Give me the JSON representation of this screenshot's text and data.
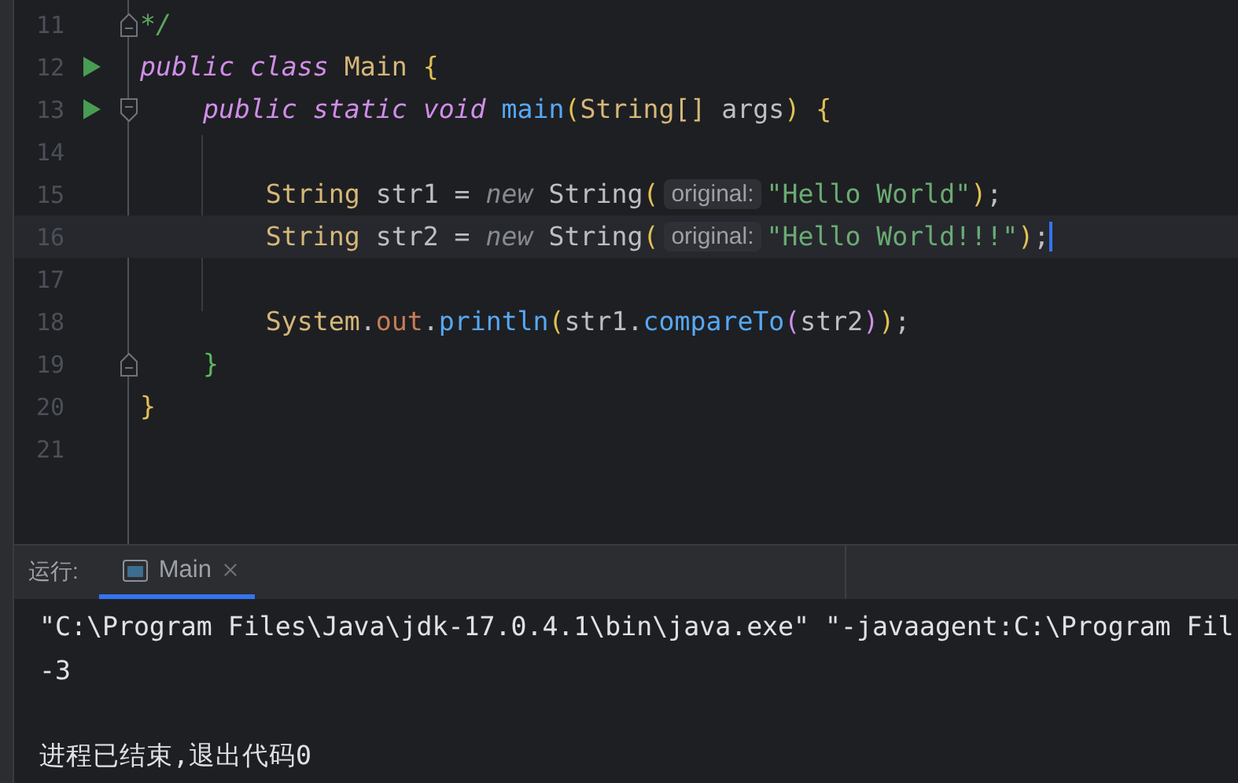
{
  "editor": {
    "lines": [
      {
        "number": "11",
        "run": false,
        "fold_start": false,
        "fold_end": true,
        "current": false,
        "tokens": [
          {
            "kind": "comment",
            "text": "*/"
          }
        ]
      },
      {
        "number": "12",
        "run": true,
        "fold_start": false,
        "fold_end": false,
        "current": false,
        "tokens": [
          {
            "kind": "kw",
            "text": "public class "
          },
          {
            "kind": "type",
            "text": "Main "
          },
          {
            "kind": "bracket",
            "text": "{"
          }
        ]
      },
      {
        "number": "13",
        "run": true,
        "fold_start": true,
        "fold_end": false,
        "current": false,
        "tokens": [
          {
            "kind": "kw",
            "text": "    public static void "
          },
          {
            "kind": "fn",
            "text": "main"
          },
          {
            "kind": "bracket",
            "text": "("
          },
          {
            "kind": "type",
            "text": "String[] "
          },
          {
            "kind": "plain",
            "text": "args"
          },
          {
            "kind": "bracket",
            "text": ") {"
          }
        ]
      },
      {
        "number": "14",
        "run": false,
        "fold_start": false,
        "fold_end": false,
        "current": false
      },
      {
        "number": "15",
        "run": false,
        "fold_start": false,
        "fold_end": false,
        "current": false,
        "tokens": [
          {
            "kind": "type",
            "text": "        String "
          },
          {
            "kind": "plain",
            "text": "str1 = "
          },
          {
            "kind": "new",
            "text": "new "
          },
          {
            "kind": "plain",
            "text": "String"
          },
          {
            "kind": "bracket",
            "text": "("
          },
          {
            "kind": "hint",
            "text": "original:"
          },
          {
            "kind": "str",
            "text": "\"Hello World\""
          },
          {
            "kind": "bracket",
            "text": ")"
          },
          {
            "kind": "plain",
            "text": ";"
          }
        ]
      },
      {
        "number": "16",
        "run": false,
        "fold_start": false,
        "fold_end": false,
        "current": true,
        "tokens": [
          {
            "kind": "type",
            "text": "        String "
          },
          {
            "kind": "plain",
            "text": "str2 = "
          },
          {
            "kind": "new",
            "text": "new "
          },
          {
            "kind": "plain",
            "text": "String"
          },
          {
            "kind": "bracket",
            "text": "("
          },
          {
            "kind": "hint",
            "text": "original:"
          },
          {
            "kind": "str",
            "text": "\"Hello World!!!\""
          },
          {
            "kind": "bracket",
            "text": ")"
          },
          {
            "kind": "plain",
            "text": ";"
          }
        ]
      },
      {
        "number": "17",
        "run": false,
        "fold_start": false,
        "fold_end": false,
        "current": false
      },
      {
        "number": "18",
        "run": false,
        "fold_start": false,
        "fold_end": false,
        "current": false,
        "tokens": [
          {
            "kind": "type",
            "text": "        System"
          },
          {
            "kind": "plain",
            "text": "."
          },
          {
            "kind": "field",
            "text": "out"
          },
          {
            "kind": "plain",
            "text": "."
          },
          {
            "kind": "fn",
            "text": "println"
          },
          {
            "kind": "bracket",
            "text": "("
          },
          {
            "kind": "plain",
            "text": "str1."
          },
          {
            "kind": "fn",
            "text": "compareTo"
          },
          {
            "kind": "inner",
            "text": "("
          },
          {
            "kind": "plain",
            "text": "str2"
          },
          {
            "kind": "inner",
            "text": ")"
          },
          {
            "kind": "bracket",
            "text": ")"
          },
          {
            "kind": "plain",
            "text": ";"
          }
        ]
      },
      {
        "number": "19",
        "run": false,
        "fold_start": false,
        "fold_end": true,
        "current": false,
        "tokens": [
          {
            "kind": "nested",
            "text": "    }"
          }
        ]
      },
      {
        "number": "20",
        "run": false,
        "fold_start": false,
        "fold_end": false,
        "current": false,
        "tokens": [
          {
            "kind": "bracket",
            "text": "}"
          }
        ]
      },
      {
        "number": "21",
        "run": false,
        "fold_start": false,
        "fold_end": false,
        "current": false
      }
    ]
  },
  "run_panel": {
    "label": "运行:",
    "tabs": [
      {
        "label": "Main",
        "selected": true
      }
    ],
    "output": [
      {
        "kind": "command",
        "text": "\"C:\\Program Files\\Java\\jdk-17.0.4.1\\bin\\java.exe\" \"-javaagent:C:\\Program Fil"
      },
      {
        "kind": "result",
        "text": "-3"
      },
      {
        "kind": "exit",
        "text": "进程已结束,退出代码0"
      }
    ]
  }
}
